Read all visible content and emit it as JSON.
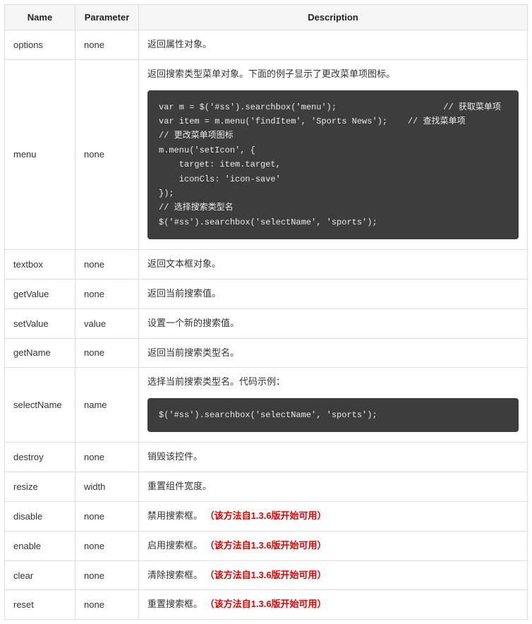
{
  "table": {
    "headers": {
      "name": "Name",
      "parameter": "Parameter",
      "description": "Description"
    },
    "version_note": "（该方法自1.3.6版开始可用）",
    "rows": [
      {
        "name": "options",
        "param": "none",
        "desc": "返回属性对象。"
      },
      {
        "name": "menu",
        "param": "none",
        "desc": "返回搜索类型菜单对象。下面的例子显示了更改菜单项图标。",
        "code": "var m = $('#ss').searchbox('menu');                     // 获取菜单项\nvar item = m.menu('findItem', 'Sports News');    // 查找菜单项\n// 更改菜单项图标\nm.menu('setIcon', {\n    target: item.target,\n    iconCls: 'icon-save'\n});\n// 选择搜索类型名\n$('#ss').searchbox('selectName', 'sports');"
      },
      {
        "name": "textbox",
        "param": "none",
        "desc": "返回文本框对象。"
      },
      {
        "name": "getValue",
        "param": "none",
        "desc": "返回当前搜索值。"
      },
      {
        "name": "setValue",
        "param": "value",
        "desc": "设置一个新的搜索值。"
      },
      {
        "name": "getName",
        "param": "none",
        "desc": "返回当前搜索类型名。"
      },
      {
        "name": "selectName",
        "param": "name",
        "desc": "选择当前搜索类型名。代码示例：",
        "code": "$('#ss').searchbox('selectName', 'sports');"
      },
      {
        "name": "destroy",
        "param": "none",
        "desc": "销毁该控件。"
      },
      {
        "name": "resize",
        "param": "width",
        "desc": "重置组件宽度。"
      },
      {
        "name": "disable",
        "param": "none",
        "desc": "禁用搜索框。",
        "has_note": true
      },
      {
        "name": "enable",
        "param": "none",
        "desc": "启用搜索框。",
        "has_note": true
      },
      {
        "name": "clear",
        "param": "none",
        "desc": "清除搜索框。",
        "has_note": true
      },
      {
        "name": "reset",
        "param": "none",
        "desc": "重置搜索框。",
        "has_note": true
      }
    ]
  }
}
